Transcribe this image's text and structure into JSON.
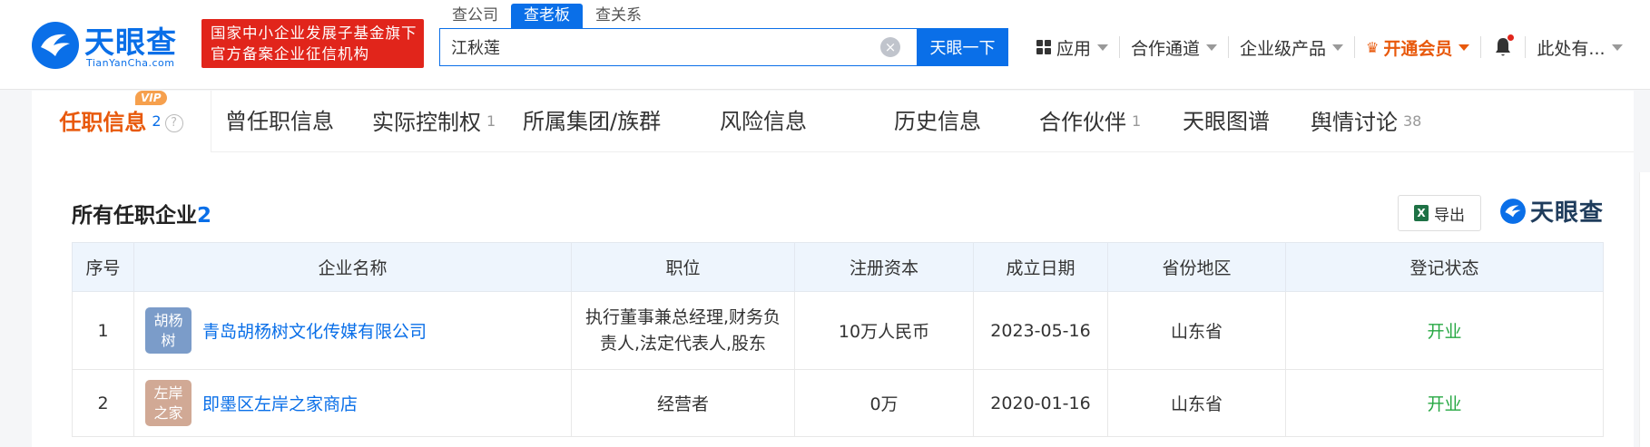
{
  "header": {
    "logo_text": "天眼查",
    "logo_sub": "TianYanCha.com",
    "banner_line1": "国家中小企业发展子基金旗下",
    "banner_line2": "官方备案企业征信机构",
    "search_tabs": [
      "查公司",
      "查老板",
      "查关系"
    ],
    "search_value": "江秋莲",
    "search_button": "天眼一下",
    "nav": {
      "apps": "应用",
      "channel": "合作通道",
      "enterprise": "企业级产品",
      "vip": "开通会员",
      "user": "此处有..."
    }
  },
  "tabs": {
    "active_label": "任职信息",
    "active_count": "2",
    "vip_badge": "VIP",
    "items": [
      {
        "label": "曾任职信息",
        "count": ""
      },
      {
        "label": "实际控制权",
        "count": "1"
      },
      {
        "label": "所属集团/族群",
        "count": ""
      },
      {
        "label": "风险信息",
        "count": ""
      },
      {
        "label": "历史信息",
        "count": ""
      },
      {
        "label": "合作伙伴",
        "count": "1"
      },
      {
        "label": "天眼图谱",
        "count": ""
      },
      {
        "label": "舆情讨论",
        "count": "38"
      }
    ]
  },
  "section": {
    "title": "所有任职企业",
    "count": "2",
    "export_label": "导出",
    "watermark": "天眼查"
  },
  "table": {
    "headers": [
      "序号",
      "企业名称",
      "职位",
      "注册资本",
      "成立日期",
      "省份地区",
      "登记状态"
    ],
    "rows": [
      {
        "index": "1",
        "avatar_text": "胡杨树",
        "avatar_color": "#7b9cc9",
        "company": "青岛胡杨树文化传媒有限公司",
        "position": "执行董事兼总经理,财务负责人,法定代表人,股东",
        "capital": "10万人民币",
        "date": "2023-05-16",
        "province": "山东省",
        "status": "开业"
      },
      {
        "index": "2",
        "avatar_text": "左岸之家",
        "avatar_color": "#d1a995",
        "company": "即墨区左岸之家商店",
        "position": "经营者",
        "capital": "0万",
        "date": "2020-01-16",
        "province": "山东省",
        "status": "开业"
      }
    ]
  }
}
